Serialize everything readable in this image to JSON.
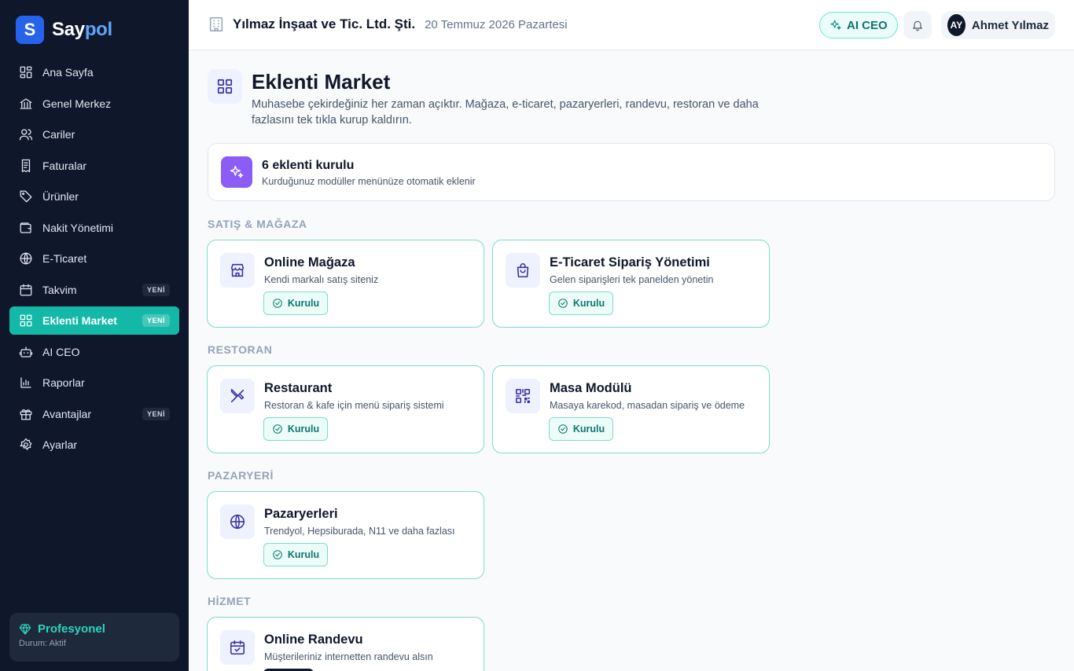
{
  "brand": {
    "logo_letter": "S",
    "name_part1": "Say",
    "name_part2": "pol"
  },
  "sidebar": {
    "items": [
      {
        "label": "Ana Sayfa",
        "icon": "dashboard-icon"
      },
      {
        "label": "Genel Merkez",
        "icon": "bank-icon"
      },
      {
        "label": "Cariler",
        "icon": "users-icon"
      },
      {
        "label": "Faturalar",
        "icon": "invoice-icon"
      },
      {
        "label": "Ürünler",
        "icon": "tag-icon"
      },
      {
        "label": "Nakit Yönetimi",
        "icon": "wallet-icon"
      },
      {
        "label": "E-Ticaret",
        "icon": "globe-icon"
      },
      {
        "label": "Takvim",
        "icon": "calendar-icon",
        "badge": "YENİ"
      },
      {
        "label": "Eklenti Market",
        "icon": "grid-icon",
        "badge": "YENİ",
        "active": true
      },
      {
        "label": "AI CEO",
        "icon": "robot-icon"
      },
      {
        "label": "Raporlar",
        "icon": "chart-icon"
      },
      {
        "label": "Avantajlar",
        "icon": "gift-icon",
        "badge": "YENİ"
      },
      {
        "label": "Ayarlar",
        "icon": "gear-icon"
      }
    ],
    "plan": {
      "name": "Profesyonel",
      "status": "Durum: Aktif"
    }
  },
  "header": {
    "company": "Yılmaz İnşaat ve Tic. Ltd. Şti.",
    "date": "20 Temmuz 2026 Pazartesi",
    "ai_button": "AI CEO",
    "user": {
      "initials": "AY",
      "name": "Ahmet Yılmaz"
    }
  },
  "page": {
    "title": "Eklenti Market",
    "subtitle": "Muhasebe çekirdeğiniz her zaman açıktır. Mağaza, e-ticaret, pazaryerleri, randevu, restoran ve daha fazlasını tek tıkla kurup kaldırın.",
    "summary": {
      "title": "6 eklenti kurulu",
      "subtitle": "Kurduğunuz modüller menünüze otomatik eklenir"
    }
  },
  "sections": [
    {
      "label": "SATIŞ & MAĞAZA",
      "cards": [
        {
          "title": "Online Mağaza",
          "desc": "Kendi markalı satış siteniz",
          "status": "Kurulu",
          "icon": "store-icon"
        },
        {
          "title": "E-Ticaret Sipariş Yönetimi",
          "desc": "Gelen siparişleri tek panelden yönetin",
          "status": "Kurulu",
          "icon": "shopping-bag-icon"
        }
      ]
    },
    {
      "label": "RESTORAN",
      "cards": [
        {
          "title": "Restaurant",
          "desc": "Restoran & kafe için menü sipariş sistemi",
          "status": "Kurulu",
          "icon": "utensils-icon"
        },
        {
          "title": "Masa Modülü",
          "desc": "Masaya karekod, masadan sipariş ve ödeme",
          "status": "Kurulu",
          "icon": "qr-code-icon"
        }
      ]
    },
    {
      "label": "PAZARYERİ",
      "cards": [
        {
          "title": "Pazaryerleri",
          "desc": "Trendyol, Hepsiburada, N11 ve daha fazlası",
          "status": "Kurulu",
          "icon": "globe-icon"
        }
      ]
    },
    {
      "label": "HİZMET",
      "cards": [
        {
          "title": "Online Randevu",
          "desc": "Müşterileriniz internetten randevu alsın",
          "status": "",
          "icon": "calendar-check-icon"
        }
      ]
    }
  ],
  "colors": {
    "sidebar_bg": "#0f172a",
    "accent": "#14b8a6",
    "brand_blue": "#2563eb",
    "summary_icon": "#8b5cf6"
  }
}
